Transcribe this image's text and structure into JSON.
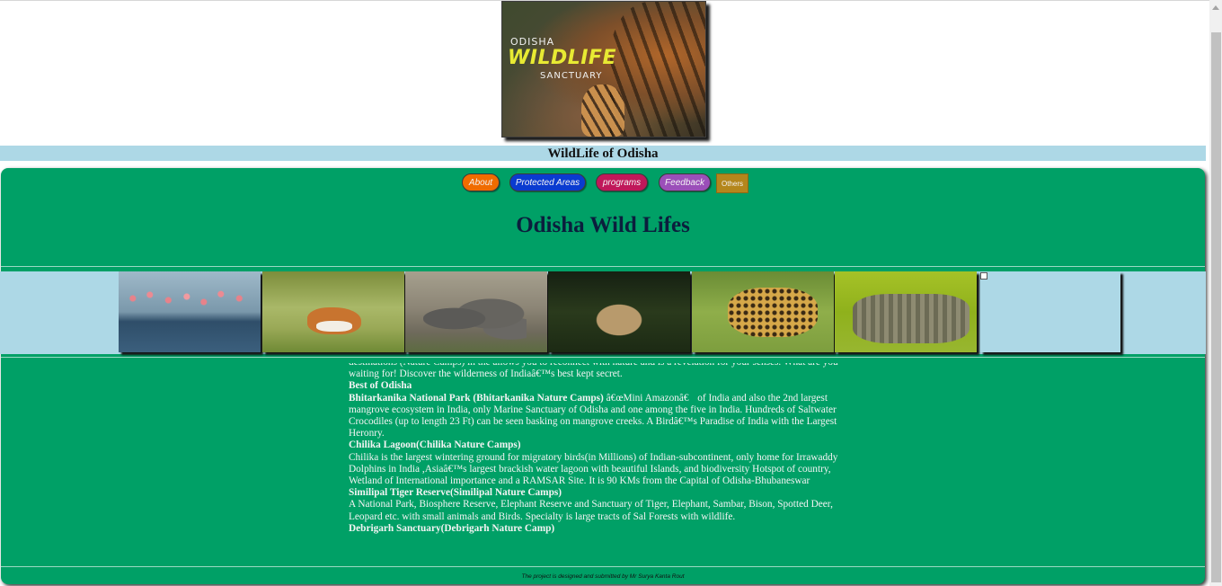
{
  "banner": {
    "line1": "ODISHA",
    "line2": "WILDLIFE",
    "line3": "SANCTUARY"
  },
  "title_strip": "WildLife of Odisha",
  "nav": {
    "about": "About",
    "protected_areas": "Protected Areas",
    "programs": "programs",
    "feedback": "Feedback",
    "others": "Others"
  },
  "heading": "Odisha Wild Lifes",
  "gallery": {
    "images": [
      "flamingos",
      "antelope",
      "elephants",
      "deer",
      "leopard",
      "crocodiles",
      "broken-image"
    ]
  },
  "content": {
    "intro": "destinations (Nature Camps) in the allows you to reconnect with nature and is a revelation for your senses. What are you waiting for! Discover the wilderness of Indiaâ€™s best kept secret.",
    "best_heading": "Best of Odisha",
    "bhitarkanika_title": "Bhitarkanika National Park (Bhitarkanika Nature Camps)",
    "bhitarkanika_text": " â€œMini Amazonâ€ of India and also the 2nd largest mangrove ecosystem in India, only Marine Sanctuary of Odisha and one among the five in India. Hundreds of Saltwater Crocodiles (up to length 23 Ft) can be seen basking on mangrove creeks. A Birdâ€™s Paradise of India with the Largest Heronry.",
    "chilika_title": "Chilika Lagoon(Chilika Nature Camps)",
    "chilika_text": "Chilika is the largest wintering ground for migratory birds(in Millions) of Indian-subcontinent, only home for Irrawaddy Dolphins in India ,Asiaâ€™s largest brackish water lagoon with beautiful Islands, and biodiversity Hotspot of country, Wetland of International importance and a RAMSAR Site. It is 90 KMs from the Capital of Odisha-Bhubaneswar",
    "similipal_title": "Similipal Tiger Reserve(Similipal Nature Camps)",
    "similipal_text": "A National Park, Biosphere Reserve, Elephant Reserve and Sanctuary of Tiger, Elephant, Sambar, Bison, Spotted Deer, Leopard etc. with small animals and Birds. Specialty is large tracts of Sal Forests with wildlife.",
    "debrigarh_title": "Debrigarh Sanctuary(Debrigarh Nature Camp)"
  },
  "footer": "The project is designed and submitted by Mr Surya Kanta Rout"
}
